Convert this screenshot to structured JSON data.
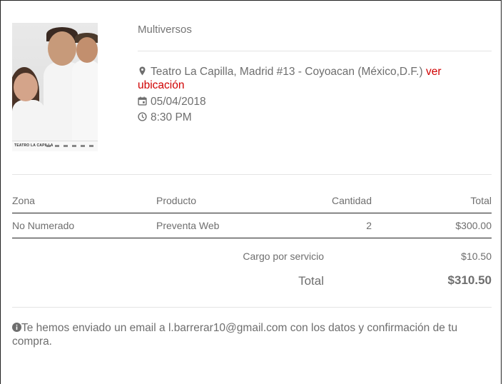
{
  "event": {
    "title": "Multiversos",
    "venue": "Teatro La Capilla, Madrid #13 - Coyoacan (México,D.F.)",
    "map_link": "ver ubicación",
    "date": "05/04/2018",
    "time": "8:30 PM",
    "poster_text": "TEATRO LA CAPILLA"
  },
  "table": {
    "headers": {
      "zona": "Zona",
      "producto": "Producto",
      "cantidad": "Cantidad",
      "total": "Total"
    },
    "rows": [
      {
        "zona": "No Numerado",
        "producto": "Preventa Web",
        "cantidad": "2",
        "total": "$300.00"
      }
    ]
  },
  "summary": {
    "service_label": "Cargo por servicio",
    "service_value": "$10.50",
    "total_label": "Total",
    "total_value": "$310.50"
  },
  "notice": {
    "text_before": "Te hemos enviado un email a ",
    "email": "l.barrerar10@gmail.com",
    "text_after": " con los datos y confirmación de tu compra."
  },
  "colors": {
    "link": "#d00000",
    "text": "#6e6e6e",
    "divider": "#e4e4e4"
  }
}
